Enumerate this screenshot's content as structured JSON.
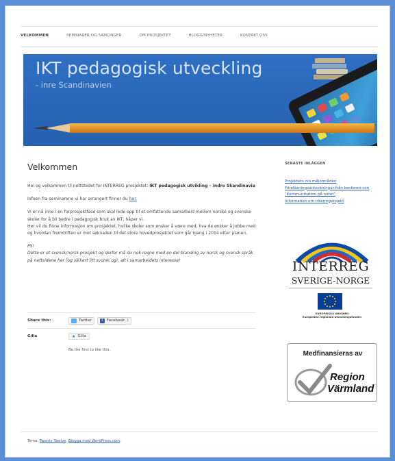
{
  "nav": {
    "items": [
      {
        "label": "VELKOMMEN",
        "active": true
      },
      {
        "label": "SEMINARER OG SAMLINGER",
        "active": false
      },
      {
        "label": "OM PROSJEKTET",
        "active": false
      },
      {
        "label": "BLOGG/NYHETER",
        "active": false
      },
      {
        "label": "KONTAKT OSS",
        "active": false
      }
    ]
  },
  "banner": {
    "title": "IKT pedagogisk utveckling",
    "subtitle": "- inre Scandinavien"
  },
  "post": {
    "title": "Velkommen",
    "intro_prefix": "Hei og velkommen til nettstedet for INTERREG prosjektet: ",
    "intro_bold": "IKT pedagogisk utvikling – indre Skandinavia",
    "info_prefix": "Infoen fra seminarene vi har arrangert finner du ",
    "info_link": "her.",
    "para3_line1": "Vi er nå inne i en forprosjektfase som skal lede opp til et omfattende samarbeid mellom norske og svenske skoler for å bli bedre i pedagogisk bruk av IKT, håper vi.",
    "para3_line2": "Her vil du finne informasjon om prosjektet, hvilke skoler som ønsker å være med, hva de ønsker å jobbe med og hvordan fremdriften er mot søknaden til det store hovedprosjektet som går igang i 2014 etter planen.",
    "ps_label": "PS!",
    "ps_text": "Dette er et svensk/norsk prosjekt og derfor må du nok regne med en del blanding av norsk og svensk språk på nettsidene her (og sikkert litt svorsk og), alt i samarbeidets interesse!"
  },
  "share": {
    "label": "Share this:",
    "twitter": "Twitter",
    "facebook": "Facebook",
    "facebook_count": "1"
  },
  "like": {
    "label": "Gilla",
    "button": "Gilla",
    "first_text": "Be the first to like this."
  },
  "sidebar": {
    "heading": "SENASTE INLÄGGEN",
    "links": [
      "Projektets nio målområden",
      "Föreläsningsanteckningar från konferen-sen \"Kommunikation på nätet\"",
      "Information om interregprojekt"
    ]
  },
  "interreg_logo": {
    "name": "INTERREG",
    "region": "SVERIGE-NORGE",
    "eu_line1": "EUROPEISKA UNIONEN",
    "eu_line2": "Europeiska regionala utvecklingsfonden"
  },
  "medfin": {
    "title": "Medfinansieras av",
    "region_word1": "Region",
    "region_word2": "Värmland"
  },
  "footer": {
    "prefix": "Tema: ",
    "theme_link": "Twenty Twelve",
    "separator": ". ",
    "blog_link": "Blogga med WordPress.com",
    "suffix": "."
  },
  "colors": {
    "background": "#5a8fd8",
    "link": "#2a5fa8",
    "banner_blue": "#2b68b9"
  }
}
